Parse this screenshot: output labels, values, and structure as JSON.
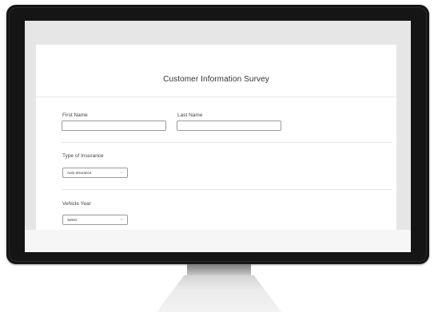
{
  "survey": {
    "title": "Customer Information Survey",
    "first_name_label": "First Name",
    "first_name_value": "",
    "last_name_label": "Last Name",
    "last_name_value": "",
    "insurance_label": "Type of Insurance",
    "insurance_selected": "Auto Insurance",
    "vehicle_year_label": "Vehicle Year",
    "vehicle_year_selected": "Select"
  },
  "icons": {
    "dropdown": "chevron-down-icon"
  }
}
